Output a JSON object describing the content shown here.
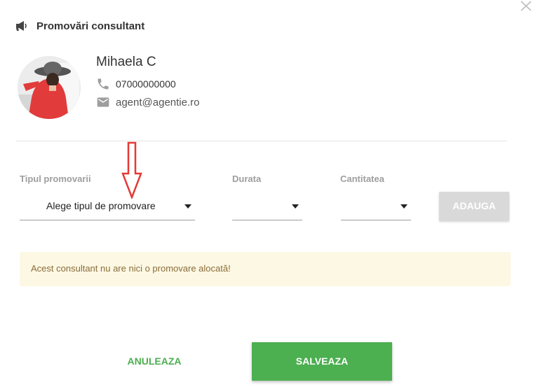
{
  "dialog": {
    "title": "Promovări consultant",
    "close_icon": "close-icon",
    "header_icon": "megaphone-icon"
  },
  "agent": {
    "name": "Mihaela C",
    "phone": "07000000000",
    "email": "agent@agentie.ro",
    "phone_icon": "phone-icon",
    "email_icon": "envelope-icon"
  },
  "form": {
    "type_label": "Tipul promovarii",
    "type_value": "Alege tipul de promovare",
    "duration_label": "Durata",
    "duration_value": "",
    "quantity_label": "Cantitatea",
    "quantity_value": "",
    "add_label": "ADAUGA"
  },
  "alert": {
    "message": "Acest consultant nu are nici o promovare alocată!"
  },
  "footer": {
    "cancel_label": "ANULEAZA",
    "save_label": "SALVEAZA"
  },
  "colors": {
    "accent_green": "#4caf50",
    "alert_bg": "#fcf8e3",
    "alert_text": "#8a6d3b",
    "annotation_arrow": "#e53935"
  }
}
